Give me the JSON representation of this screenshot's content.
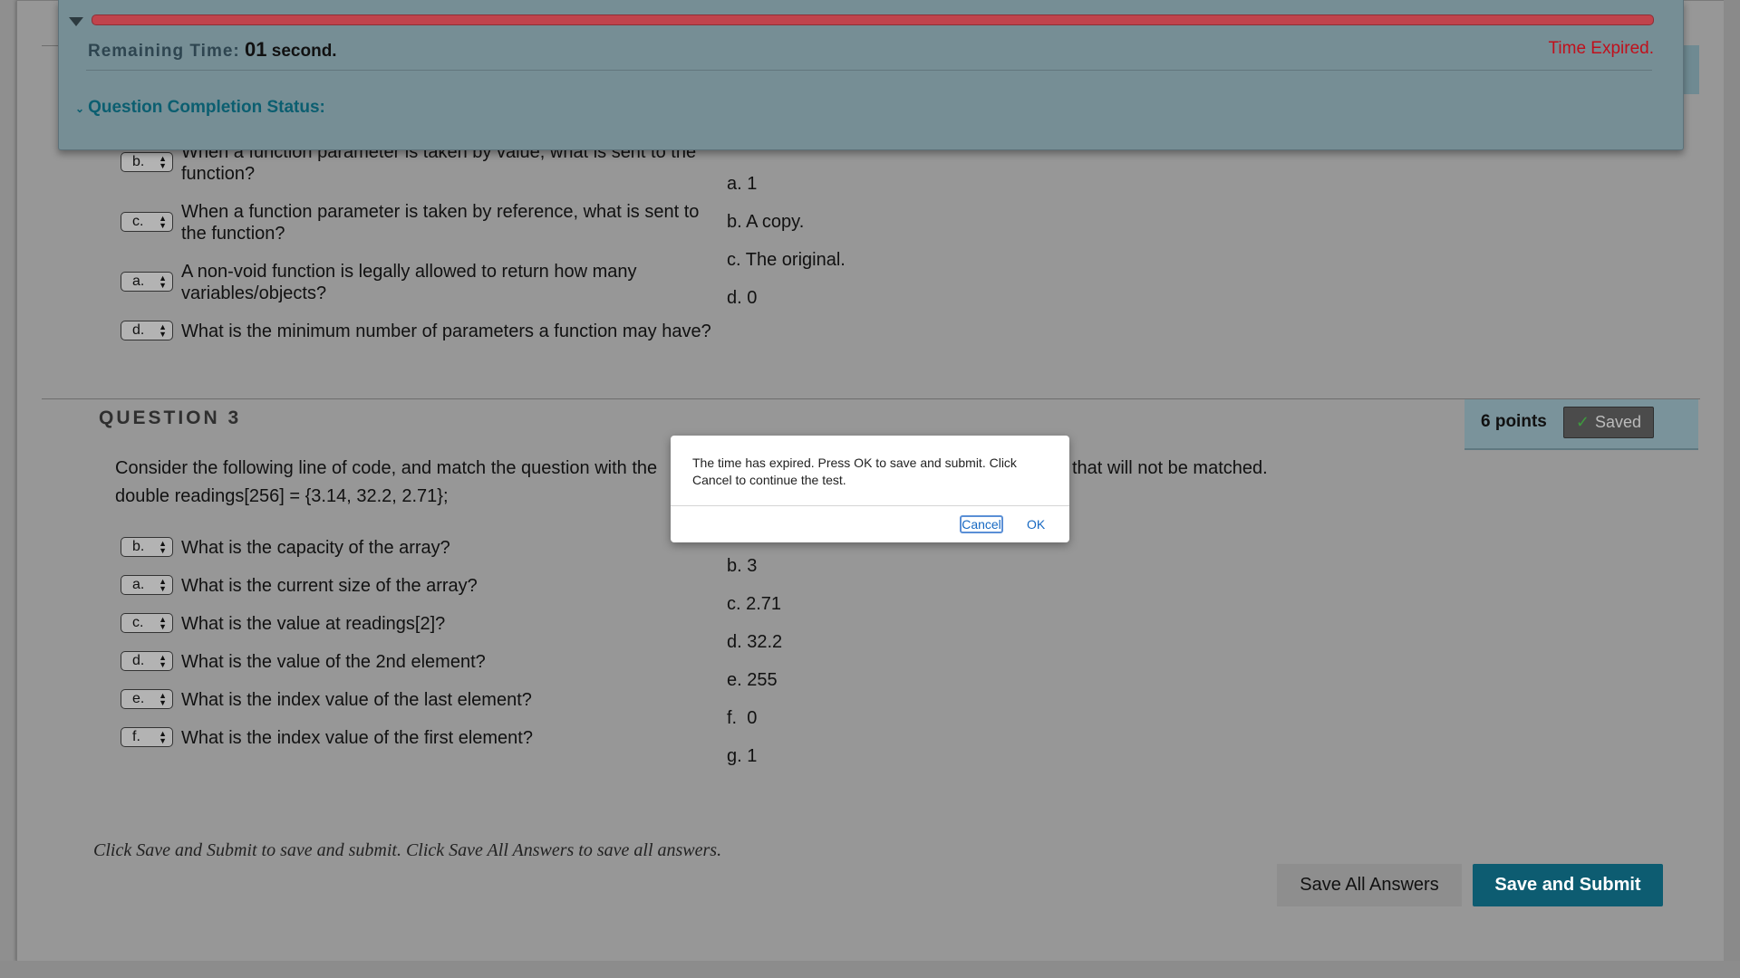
{
  "timer": {
    "label": "Remaining Time:",
    "value": "01",
    "unit": "second.",
    "status": "Time Expired.",
    "completion_label": "Question Completion Status:"
  },
  "question2": {
    "items": [
      {
        "selected": "b.",
        "text": "When a function parameter is taken by value, what is sent to the function?"
      },
      {
        "selected": "c.",
        "text": "When a function parameter is taken by reference, what is sent to the function?"
      },
      {
        "selected": "a.",
        "text": "A non-void function is legally allowed to return how many variables/objects?"
      },
      {
        "selected": "d.",
        "text": "What is the minimum number of parameters a function may have?"
      }
    ],
    "answers": [
      {
        "letter": "a.",
        "text": "1"
      },
      {
        "letter": "b.",
        "text": "A copy."
      },
      {
        "letter": "c.",
        "text": "The original."
      },
      {
        "letter": "d.",
        "text": "0"
      }
    ]
  },
  "question3": {
    "title": "QUESTION 3",
    "points": "6 points",
    "saved_label": "Saved",
    "instruction_left": "Consider the following line of code, and match the question with the",
    "instruction_right": "that will not be matched.",
    "code": "double readings[256] = {3.14, 32.2, 2.71};",
    "items": [
      {
        "selected": "b.",
        "text": "What is the capacity of the array?"
      },
      {
        "selected": "a.",
        "text": "What is the current size of the array?"
      },
      {
        "selected": "c.",
        "text": "What is the value at readings[2]?"
      },
      {
        "selected": "d.",
        "text": "What is the value of the 2nd element?"
      },
      {
        "selected": "e.",
        "text": "What is the index value of the last element?"
      },
      {
        "selected": "f.",
        "text": "What is the index value of the first element?"
      }
    ],
    "answers": [
      {
        "letter": "b.",
        "text": "3"
      },
      {
        "letter": "c.",
        "text": "2.71"
      },
      {
        "letter": "d.",
        "text": "32.2"
      },
      {
        "letter": "e.",
        "text": "255"
      },
      {
        "letter": "f.",
        "text": "0"
      },
      {
        "letter": "g.",
        "text": "1"
      }
    ]
  },
  "footer": {
    "instruction": "Click Save and Submit to save and submit. Click Save All Answers to save all answers.",
    "save_all_label": "Save All Answers",
    "submit_label": "Save and Submit"
  },
  "dialog": {
    "message": "The time has expired.  Press OK to save and submit. Click Cancel to continue the test.",
    "cancel_label": "Cancel",
    "ok_label": "OK"
  },
  "colors": {
    "expired_red": "#c0101c",
    "teal_heading": "#0d5c71",
    "submit_bg": "#0d5c71",
    "dialog_link": "#1769c2"
  }
}
